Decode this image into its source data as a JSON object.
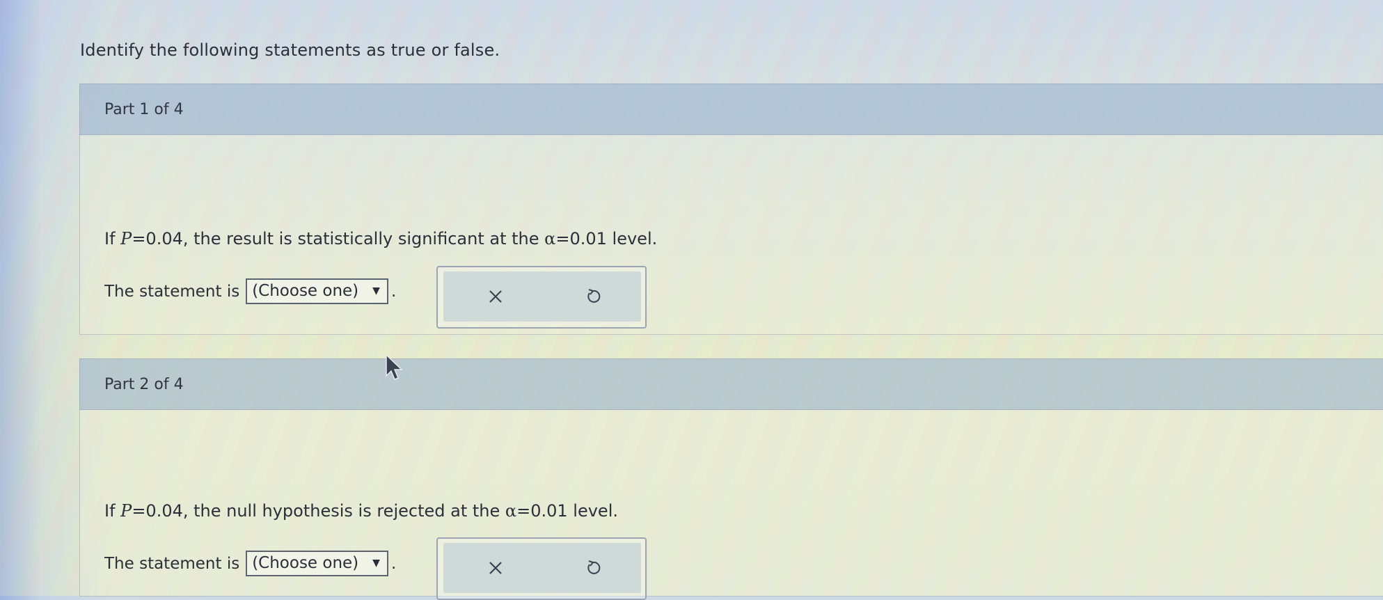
{
  "instructions": "Identify the following statements as true or false.",
  "parts": [
    {
      "header": "Part 1 of 4",
      "question_prefix": "If ",
      "question_var": "P",
      "question_mid": "=0.04, the result is statistically significant at the ",
      "question_alpha": "α",
      "question_suffix": "=0.01 level.",
      "statement_label": "The statement is",
      "select_value": "(Choose one)",
      "period": "."
    },
    {
      "header": "Part 2 of 4",
      "question_prefix": "If ",
      "question_var": "P",
      "question_mid": "=0.04, the null hypothesis is rejected at the ",
      "question_alpha": "α",
      "question_suffix": "=0.01 level.",
      "statement_label": "The statement is",
      "select_value": "(Choose one)",
      "period": "."
    }
  ],
  "icons": {
    "clear": "close-icon",
    "reset": "undo-icon",
    "dropdown": "caret-down-icon"
  },
  "colors": {
    "header_bg": "#96afcd",
    "text": "#2b2f3a"
  }
}
